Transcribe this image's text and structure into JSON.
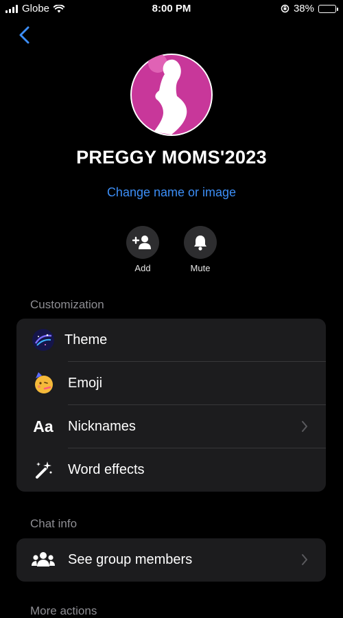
{
  "status_bar": {
    "carrier": "Globe",
    "time": "8:00 PM",
    "battery_percent": "38%",
    "battery_level": 0.38
  },
  "header": {
    "back_icon": "chevron-left-icon"
  },
  "group": {
    "name": "PREGGY MOMS'2023",
    "change_label": "Change name or image",
    "avatar_icon": "pregnant-woman-silhouette-icon"
  },
  "actions": [
    {
      "label": "Add",
      "icon": "add-person-icon"
    },
    {
      "label": "Mute",
      "icon": "bell-icon"
    }
  ],
  "customization": {
    "header": "Customization",
    "items": [
      {
        "label": "Theme",
        "icon": "galaxy-theme-icon"
      },
      {
        "label": "Emoji",
        "icon": "partying-face-emoji-icon"
      },
      {
        "label": "Nicknames",
        "icon": "aa-text-icon",
        "glyph": "Aa"
      },
      {
        "label": "Word effects",
        "icon": "magic-wand-icon"
      }
    ]
  },
  "chat_info": {
    "header": "Chat info",
    "items": [
      {
        "label": "See group members",
        "icon": "people-group-icon"
      }
    ]
  },
  "more_actions": {
    "header": "More actions"
  },
  "colors": {
    "accent": "#3c8ef6",
    "background": "#000000",
    "card": "#1c1c1e",
    "avatar_pink": "#c8379a"
  }
}
